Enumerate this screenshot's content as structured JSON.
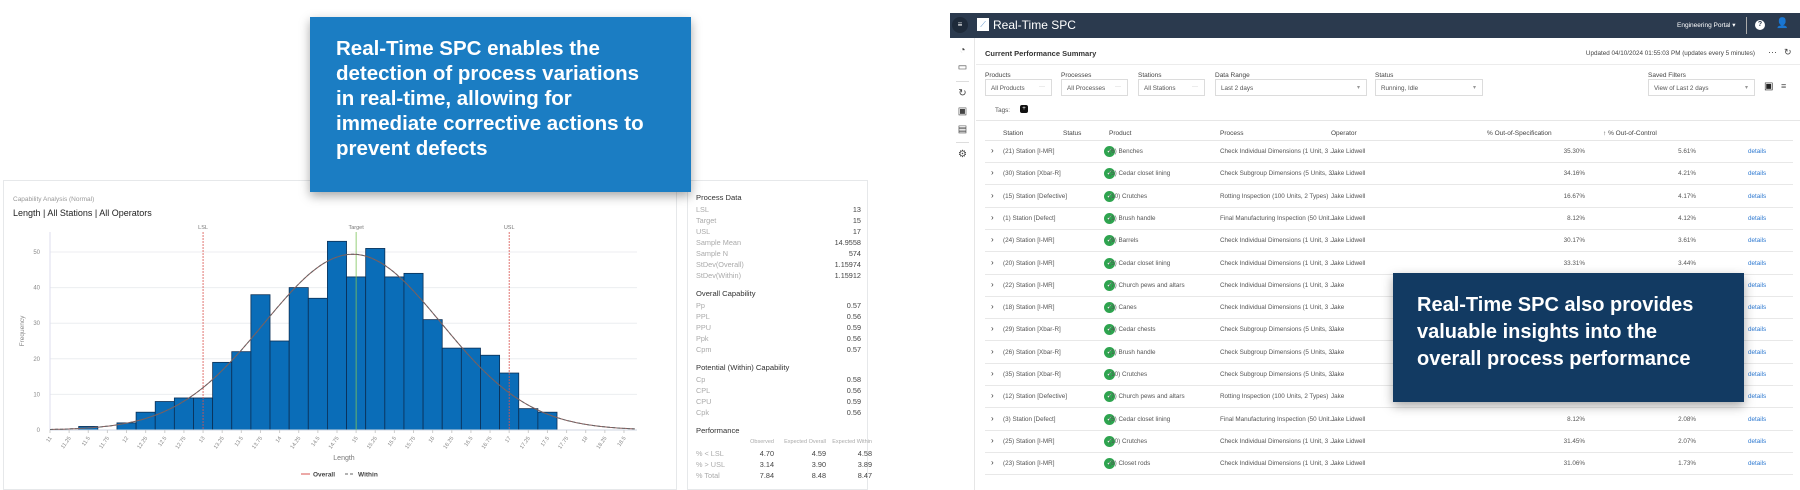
{
  "callouts": {
    "top": [
      "Real-Time SPC enables the",
      "detection of process variations",
      "in real-time, allowing for",
      "immediate corrective actions to",
      "prevent defects"
    ],
    "bottom": [
      "Real-Time SPC also provides",
      "valuable insights into the",
      "overall process performance"
    ]
  },
  "capability": {
    "subtitle": "Capability Analysis (Normal)",
    "title": "Length | All Stations | All Operators",
    "icons": {
      "settings": "gear-icon"
    }
  },
  "chart_data": {
    "type": "bar",
    "title": "Length | All Stations | All Operators",
    "xlabel": "Length",
    "ylabel": "Frequency",
    "bin_width": 0.25,
    "x": [
      11.5,
      11.75,
      12,
      12.25,
      12.5,
      12.75,
      13,
      13.25,
      13.5,
      13.75,
      14,
      14.25,
      14.5,
      14.75,
      15,
      15.25,
      15.5,
      15.75,
      16,
      16.25,
      16.5,
      16.75,
      17,
      17.25,
      17.5
    ],
    "values": [
      1,
      0,
      2,
      5,
      8,
      9,
      9,
      19,
      22,
      38,
      25,
      40,
      37,
      53,
      43,
      51,
      43,
      44,
      31,
      23,
      23,
      21,
      16,
      6,
      5
    ],
    "xlim": [
      11,
      18.67
    ],
    "ylim": [
      0,
      56
    ],
    "x_ticks": [
      "11",
      "11.25",
      "11.5",
      "11.75",
      "12",
      "12.25",
      "12.5",
      "12.75",
      "13",
      "13.25",
      "13.5",
      "13.75",
      "14",
      "14.25",
      "14.5",
      "14.75",
      "15",
      "15.25",
      "15.5",
      "15.75",
      "16",
      "16.25",
      "16.5",
      "16.75",
      "17",
      "17.25",
      "17.5",
      "17.75",
      "18",
      "18.25",
      "18.5"
    ],
    "y_ticks": [
      0,
      10,
      20,
      30,
      40,
      50
    ],
    "grid": true,
    "reference_lines": [
      {
        "label": "LSL",
        "value": 13,
        "color": "#d9534f"
      },
      {
        "label": "Target",
        "value": 15,
        "color": "#7cc35a"
      },
      {
        "label": "USL",
        "value": 17,
        "color": "#d9534f"
      }
    ],
    "curves": [
      {
        "name": "Overall",
        "mean": 14.9558,
        "sd": 1.15974,
        "color": "#8a5a5a",
        "style": "solid"
      },
      {
        "name": "Within",
        "mean": 14.9558,
        "sd": 1.15912,
        "color": "#666666",
        "style": "dashed"
      }
    ],
    "n": 574,
    "bar_color": "#0a6db8",
    "legend": [
      "Overall",
      "Within"
    ],
    "legend_position": "bottom"
  },
  "stats": {
    "process_data": {
      "title": "Process Data",
      "rows": [
        [
          "LSL",
          "13"
        ],
        [
          "Target",
          "15"
        ],
        [
          "USL",
          "17"
        ],
        [
          "Sample Mean",
          "14.9558"
        ],
        [
          "Sample N",
          "574"
        ],
        [
          "StDev(Overall)",
          "1.15974"
        ],
        [
          "StDev(Within)",
          "1.15912"
        ]
      ]
    },
    "overall": {
      "title": "Overall Capability",
      "rows": [
        [
          "Pp",
          "0.57"
        ],
        [
          "PPL",
          "0.56"
        ],
        [
          "PPU",
          "0.59"
        ],
        [
          "Ppk",
          "0.56"
        ],
        [
          "Cpm",
          "0.57"
        ]
      ]
    },
    "within": {
      "title": "Potential (Within) Capability",
      "rows": [
        [
          "Cp",
          "0.58"
        ],
        [
          "CPL",
          "0.56"
        ],
        [
          "CPU",
          "0.59"
        ],
        [
          "Cpk",
          "0.56"
        ]
      ]
    },
    "performance": {
      "title": "Performance",
      "headers": [
        "",
        "Observed",
        "Expected Overall",
        "Expected Within"
      ],
      "rows": [
        [
          "% < LSL",
          "4.70",
          "4.59",
          "4.58"
        ],
        [
          "% > USL",
          "3.14",
          "3.90",
          "3.89"
        ],
        [
          "% Total",
          "7.84",
          "8.48",
          "8.47"
        ]
      ]
    }
  },
  "app": {
    "title": "Real-Time SPC",
    "portal": "Engineering Portal",
    "page_title": "Current Performance Summary",
    "updated": "Updated 04/10/2024 01:55:03 PM (updates every 5 minutes)",
    "filters": {
      "products": {
        "label": "Products",
        "value": "All Products"
      },
      "processes": {
        "label": "Processes",
        "value": "All Processes"
      },
      "stations": {
        "label": "Stations",
        "value": "All Stations"
      },
      "range": {
        "label": "Data Range",
        "value": "Last 2 days"
      },
      "status": {
        "label": "Status",
        "value": "Running, Idle"
      },
      "saved": {
        "label": "Saved Filters",
        "value": "View of Last 2 days"
      }
    },
    "tags_label": "Tags:",
    "columns": [
      "Station",
      "Status",
      "Product",
      "Process",
      "Operator",
      "% Out-of-Specification",
      "% Out-of-Control"
    ],
    "details_label": "details",
    "rows": [
      {
        "station": "(21) Station [I-MR]",
        "product": "(6) Benches",
        "process": "Check Individual Dimensions (1 Unit, 3 ...",
        "operator": "Jake Lidwell",
        "oos": "35.30%",
        "ooc": "5.61%"
      },
      {
        "station": "(30) Station [Xbar-R]",
        "product": "(5) Cedar closet lining",
        "process": "Check Subgroup Dimensions (5 Units, 3...",
        "operator": "Jake Lidwell",
        "oos": "34.16%",
        "ooc": "4.21%"
      },
      {
        "station": "(15) Station [Defective]",
        "product": "(10) Crutches",
        "process": "Rotting Inspection (100 Units, 2 Types)",
        "operator": "Jake Lidwell",
        "oos": "16.67%",
        "ooc": "4.17%"
      },
      {
        "station": "(1) Station [Defect]",
        "product": "(1) Brush handle",
        "process": "Final Manufacturing Inspection (50 Unit...",
        "operator": "Jake Lidwell",
        "oos": "8.12%",
        "ooc": "4.12%"
      },
      {
        "station": "(24) Station [I-MR]",
        "product": "(9) Barrels",
        "process": "Check Individual Dimensions (1 Unit, 3 ...",
        "operator": "Jake Lidwell",
        "oos": "30.17%",
        "ooc": "3.61%"
      },
      {
        "station": "(20) Station [I-MR]",
        "product": "(5) Cedar closet lining",
        "process": "Check Individual Dimensions (1 Unit, 3 ...",
        "operator": "Jake Lidwell",
        "oos": "33.31%",
        "ooc": "3.44%"
      },
      {
        "station": "(22) Station [I-MR]",
        "product": "(7) Church pews and altars",
        "process": "Check Individual Dimensions (1 Unit, 3 ...",
        "operator": "Jake",
        "oos": "",
        "ooc": ""
      },
      {
        "station": "(18) Station [I-MR]",
        "product": "(3) Canes",
        "process": "Check Individual Dimensions (1 Unit, 3 ...",
        "operator": "Jake",
        "oos": "",
        "ooc": ""
      },
      {
        "station": "(29) Station [Xbar-R]",
        "product": "(4) Cedar chests",
        "process": "Check Subgroup Dimensions (5 Units, 3...",
        "operator": "Jake",
        "oos": "",
        "ooc": ""
      },
      {
        "station": "(26) Station [Xbar-R]",
        "product": "(1) Brush handle",
        "process": "Check Subgroup Dimensions (5 Units, 3...",
        "operator": "Jake",
        "oos": "",
        "ooc": ""
      },
      {
        "station": "(35) Station [Xbar-R]",
        "product": "(10) Crutches",
        "process": "Check Subgroup Dimensions (5 Units, 3...",
        "operator": "Jake",
        "oos": "",
        "ooc": ""
      },
      {
        "station": "(12) Station [Defective]",
        "product": "(7) Church pews and altars",
        "process": "Rotting Inspection (100 Units, 2 Types)",
        "operator": "Jake",
        "oos": "",
        "ooc": ""
      },
      {
        "station": "(3) Station [Defect]",
        "product": "(5) Cedar closet lining",
        "process": "Final Manufacturing Inspection (50 Unit...",
        "operator": "Jake Lidwell",
        "oos": "8.12%",
        "ooc": "2.08%"
      },
      {
        "station": "(25) Station [I-MR]",
        "product": "(10) Crutches",
        "process": "Check Individual Dimensions (1 Unit, 3 ...",
        "operator": "Jake Lidwell",
        "oos": "31.45%",
        "ooc": "2.07%"
      },
      {
        "station": "(23) Station [I-MR]",
        "product": "(8) Closet rods",
        "process": "Check Individual Dimensions (1 Unit, 3 ...",
        "operator": "Jake Lidwell",
        "oos": "31.06%",
        "ooc": "1.73%"
      }
    ]
  }
}
